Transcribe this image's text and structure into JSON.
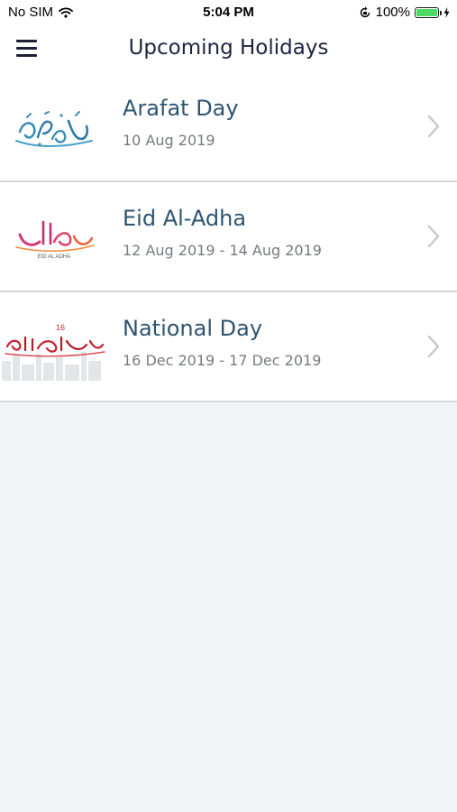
{
  "status_bar": {
    "carrier": "No SIM",
    "time": "5:04 PM",
    "battery_text": "100%",
    "battery_level": 1.0,
    "battery_color": "#4cd964",
    "icons": [
      "wifi-icon",
      "rotation-lock-icon",
      "battery-icon",
      "charging-bolt-icon"
    ]
  },
  "header": {
    "title": "Upcoming Holidays",
    "menu_icon": "hamburger-menu-icon"
  },
  "holidays": [
    {
      "title": "Arafat Day",
      "date": "10 Aug 2019",
      "thumbnail": "arafat-day-calligraphy"
    },
    {
      "title": "Eid Al-Adha",
      "date": "12 Aug 2019 - 14 Aug 2019",
      "thumbnail": "eid-al-adha-calligraphy",
      "thumbnail_caption": "EID AL ADHA"
    },
    {
      "title": "National Day",
      "date": "16 Dec 2019 - 17 Dec 2019",
      "thumbnail": "national-day-calligraphy",
      "thumbnail_caption": "16"
    }
  ],
  "colors": {
    "title": "#2e5470",
    "date": "#777a80",
    "divider": "#d5d6da",
    "background": "#f2f3f5",
    "chevron": "#c7c7cc"
  }
}
